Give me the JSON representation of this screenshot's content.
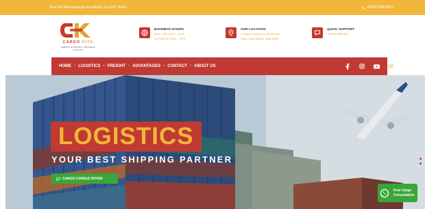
{
  "topbar": {
    "shipments": "Now 547,484 packages we delivery to 5,297 stores",
    "phone": "+6285178853673"
  },
  "logo": {
    "brand_red": "CARGO",
    "brand_gold": "KITA",
    "tagline": "FREIGHT & PROJECT INDONESIA LOGISTIC"
  },
  "header_info": [
    {
      "title": "BUSINESS HOURS",
      "lines": [
        "MON - FRI 08:00 - 17:00",
        "SATURDAY 08:00 - 14:00"
      ],
      "icon": "globe-icon"
    },
    {
      "title": "OUR LOCATION",
      "lines": [
        "Jl. Raya Gempol No. 55, Bekasi",
        "Utara, Kota Bekasi, Jawa Barat"
      ],
      "icon": "location-pin-icon"
    },
    {
      "title": "QUICK SUPPORT",
      "lines": [
        "+6285178853673"
      ],
      "icon": "chat-icon"
    }
  ],
  "nav": {
    "items": [
      "HOME",
      "LOGISTICS",
      "FREIGHT",
      "ADVANTAGES",
      "CONTACT",
      "ABOUT US"
    ]
  },
  "hero": {
    "title": "LOGISTICS",
    "subtitle": "YOUR BEST SHIPPING PARTNER",
    "cta_label": "CARGO CONSULTATION"
  },
  "whatsapp": {
    "line1": "Free Cargo",
    "line2": "Consultation"
  },
  "colors": {
    "gold": "#f2b63a",
    "red": "#c03a33",
    "green": "#3aa639"
  }
}
